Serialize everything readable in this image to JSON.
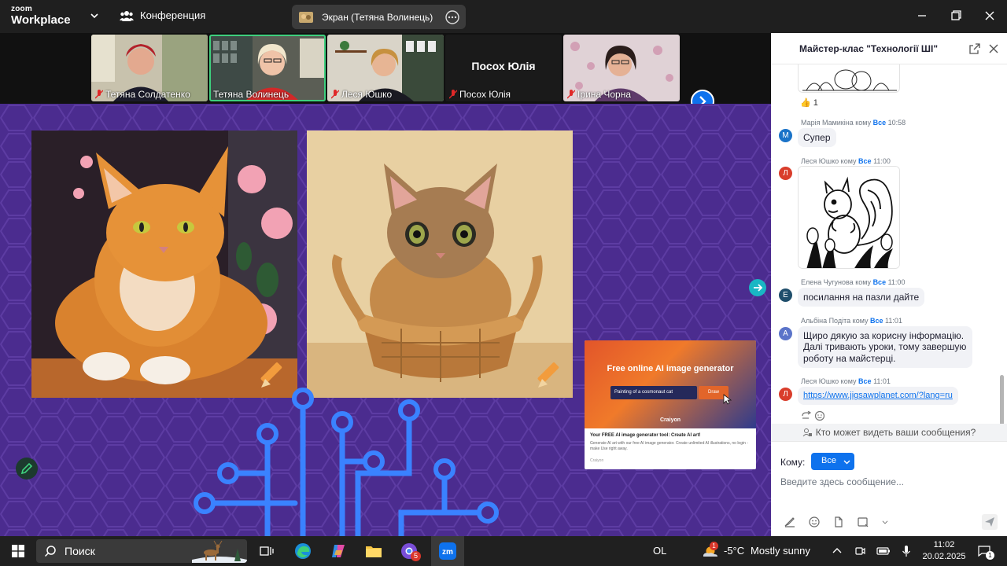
{
  "titlebar": {
    "logo_line1": "zoom",
    "logo_line2": "Workplace",
    "meeting_name": "Конференция",
    "share_label": "Экран (Тетяна Волинець)"
  },
  "participants": [
    {
      "name": "Тетяна Солдатенко",
      "video": true
    },
    {
      "name": "Тетяна Волинець",
      "video": true,
      "active": true
    },
    {
      "name": "Леся Юшко",
      "video": true
    },
    {
      "name": "Посох Юлія",
      "video": false
    },
    {
      "name": "Ірина Чорна",
      "video": true
    }
  ],
  "shared_card": {
    "hero_title": "Free online AI image generator",
    "input_text": "Painting of a cosmonaut cat",
    "button": "Draw",
    "brand": "Craiyon",
    "title": "Your FREE AI image generator tool: Create AI art!",
    "description": "Generate AI art with our free AI image generator. Create unlimited AI illustrations, no login - make Use right away.",
    "source": "Craiyon"
  },
  "chat": {
    "title": "Майстер-клас \"Технології ШІ\"",
    "reaction": {
      "emoji": "👍",
      "count": "1"
    },
    "messages": [
      {
        "sender": "Марія Мамикіна",
        "to_word": "кому",
        "to": "Все",
        "time": "10:58",
        "initial": "М",
        "color": "#1a73c8",
        "text": "Супер"
      },
      {
        "sender": "Леся Юшко",
        "to_word": "кому",
        "to": "Все",
        "time": "11:00",
        "initial": "Л",
        "color": "#d93d2b",
        "image": "squirrel-coloring"
      },
      {
        "sender": "Елена Чугунова",
        "to_word": "кому",
        "to": "Все",
        "time": "11:00",
        "initial": "Е",
        "color": "#1f4e6b",
        "text": "посилання на пазли дайте"
      },
      {
        "sender": "Альбіна Подіта",
        "to_word": "кому",
        "to": "Все",
        "time": "11:01",
        "initial": "А",
        "color": "#5b74c9",
        "text": "Щиро дякую за корисну інформацію. Далі тривають уроки, тому завершую роботу на майстерці."
      },
      {
        "sender": "Леся Юшко",
        "to_word": "кому",
        "to": "Все",
        "time": "11:01",
        "initial": "Л",
        "color": "#d93d2b",
        "link": "https://www.jigsawplanet.com/?lang=ru"
      }
    ],
    "privacy": "Кто может видеть ваши сообщения?",
    "to_label": "Кому:",
    "to_value": "Все",
    "placeholder": "Введите здесь сообщение..."
  },
  "taskbar": {
    "search": "Поиск",
    "chrome_badge": "5",
    "lang": "OL",
    "weather_badge": "1",
    "temp": "-5°C",
    "weather": "Mostly sunny",
    "time": "11:02",
    "date": "20.02.2025",
    "notif_count": "1"
  }
}
